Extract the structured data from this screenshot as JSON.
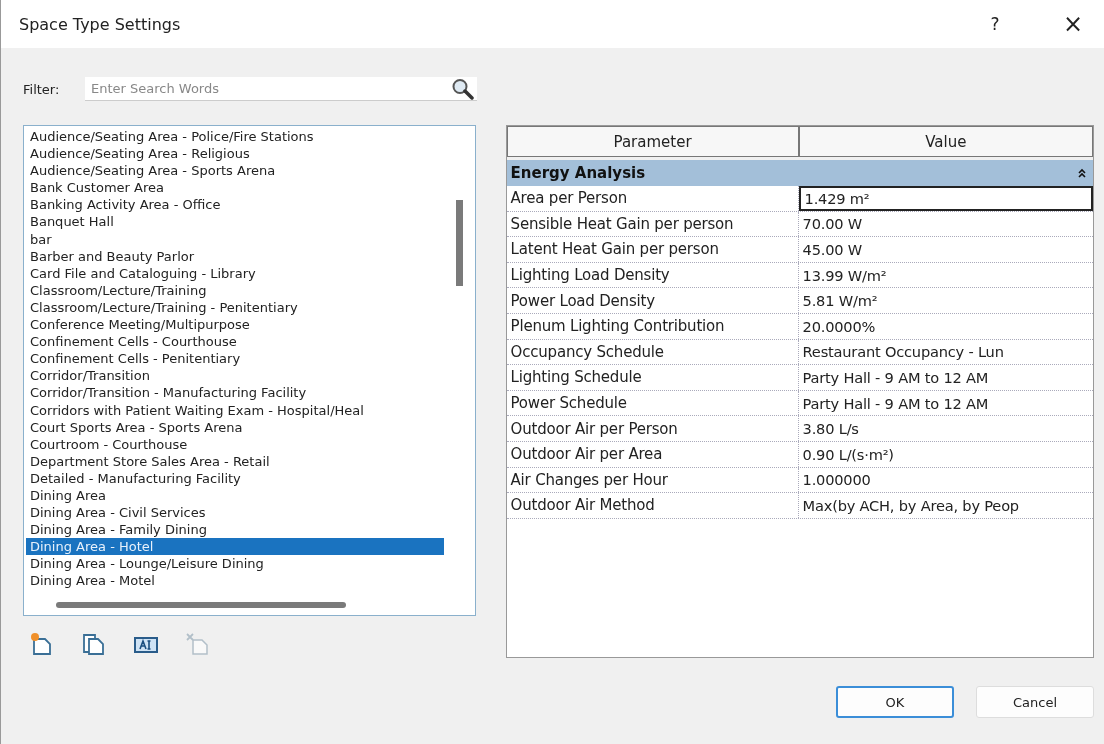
{
  "window": {
    "title": "Space Type Settings",
    "help": "?",
    "close": "×"
  },
  "filter": {
    "label": "Filter:",
    "placeholder": "Enter Search Words"
  },
  "space_types": [
    {
      "label": "Audience/Seating Area - Police/Fire Stations",
      "selected": false
    },
    {
      "label": "Audience/Seating Area - Religious",
      "selected": false
    },
    {
      "label": "Audience/Seating Area - Sports Arena",
      "selected": false
    },
    {
      "label": "Bank Customer Area",
      "selected": false
    },
    {
      "label": "Banking Activity Area - Office",
      "selected": false
    },
    {
      "label": "Banquet Hall",
      "selected": false
    },
    {
      "label": "bar",
      "selected": false
    },
    {
      "label": "Barber and Beauty Parlor",
      "selected": false
    },
    {
      "label": "Card File and Cataloguing - Library",
      "selected": false
    },
    {
      "label": "Classroom/Lecture/Training",
      "selected": false
    },
    {
      "label": "Classroom/Lecture/Training - Penitentiary",
      "selected": false
    },
    {
      "label": "Conference Meeting/Multipurpose",
      "selected": false
    },
    {
      "label": "Confinement Cells - Courthouse",
      "selected": false
    },
    {
      "label": "Confinement Cells - Penitentiary",
      "selected": false
    },
    {
      "label": "Corridor/Transition",
      "selected": false
    },
    {
      "label": "Corridor/Transition - Manufacturing Facility",
      "selected": false
    },
    {
      "label": "Corridors with Patient Waiting Exam - Hospital/Heal",
      "selected": false
    },
    {
      "label": "Court Sports Area - Sports Arena",
      "selected": false
    },
    {
      "label": "Courtroom - Courthouse",
      "selected": false
    },
    {
      "label": "Department Store Sales Area - Retail",
      "selected": false
    },
    {
      "label": "Detailed - Manufacturing Facility",
      "selected": false
    },
    {
      "label": "Dining Area",
      "selected": false
    },
    {
      "label": "Dining Area - Civil Services",
      "selected": false
    },
    {
      "label": "Dining Area - Family Dining",
      "selected": false
    },
    {
      "label": "Dining Area - Hotel",
      "selected": true
    },
    {
      "label": "Dining Area - Lounge/Leisure Dining",
      "selected": false
    },
    {
      "label": "Dining Area - Motel",
      "selected": false
    }
  ],
  "list_tools": [
    {
      "kind": "new",
      "disabled": false
    },
    {
      "kind": "duplicate",
      "disabled": false
    },
    {
      "kind": "rename",
      "disabled": false
    },
    {
      "kind": "delete",
      "disabled": true
    }
  ],
  "table": {
    "columns": [
      "Parameter",
      "Value"
    ],
    "group": {
      "title": "Energy Analysis",
      "expanded": true
    },
    "rows": [
      {
        "parameter": "Area per Person",
        "value": "1.429 m²",
        "selected": true
      },
      {
        "parameter": "Sensible Heat Gain per person",
        "value": "70.00 W",
        "selected": false
      },
      {
        "parameter": "Latent Heat Gain per person",
        "value": "45.00 W",
        "selected": false
      },
      {
        "parameter": "Lighting Load Density",
        "value": "13.99 W/m²",
        "selected": false
      },
      {
        "parameter": "Power Load Density",
        "value": "5.81 W/m²",
        "selected": false
      },
      {
        "parameter": "Plenum Lighting Contribution",
        "value": "20.0000%",
        "selected": false
      },
      {
        "parameter": "Occupancy Schedule",
        "value": "Restaurant Occupancy - Lun",
        "selected": false
      },
      {
        "parameter": "Lighting Schedule",
        "value": "Party Hall - 9 AM to 12 AM",
        "selected": false
      },
      {
        "parameter": "Power Schedule",
        "value": "Party Hall - 9 AM to 12 AM",
        "selected": false
      },
      {
        "parameter": "Outdoor Air per Person",
        "value": "3.80 L/s",
        "selected": false
      },
      {
        "parameter": "Outdoor Air per Area",
        "value": "0.90 L/(s·m²)",
        "selected": false
      },
      {
        "parameter": "Air Changes per Hour",
        "value": "1.000000",
        "selected": false
      },
      {
        "parameter": "Outdoor Air Method",
        "value": "Max(by ACH, by Area, by Peop",
        "selected": false
      }
    ]
  },
  "buttons": [
    {
      "label": "OK",
      "default": true
    },
    {
      "label": "Cancel",
      "default": false
    }
  ]
}
